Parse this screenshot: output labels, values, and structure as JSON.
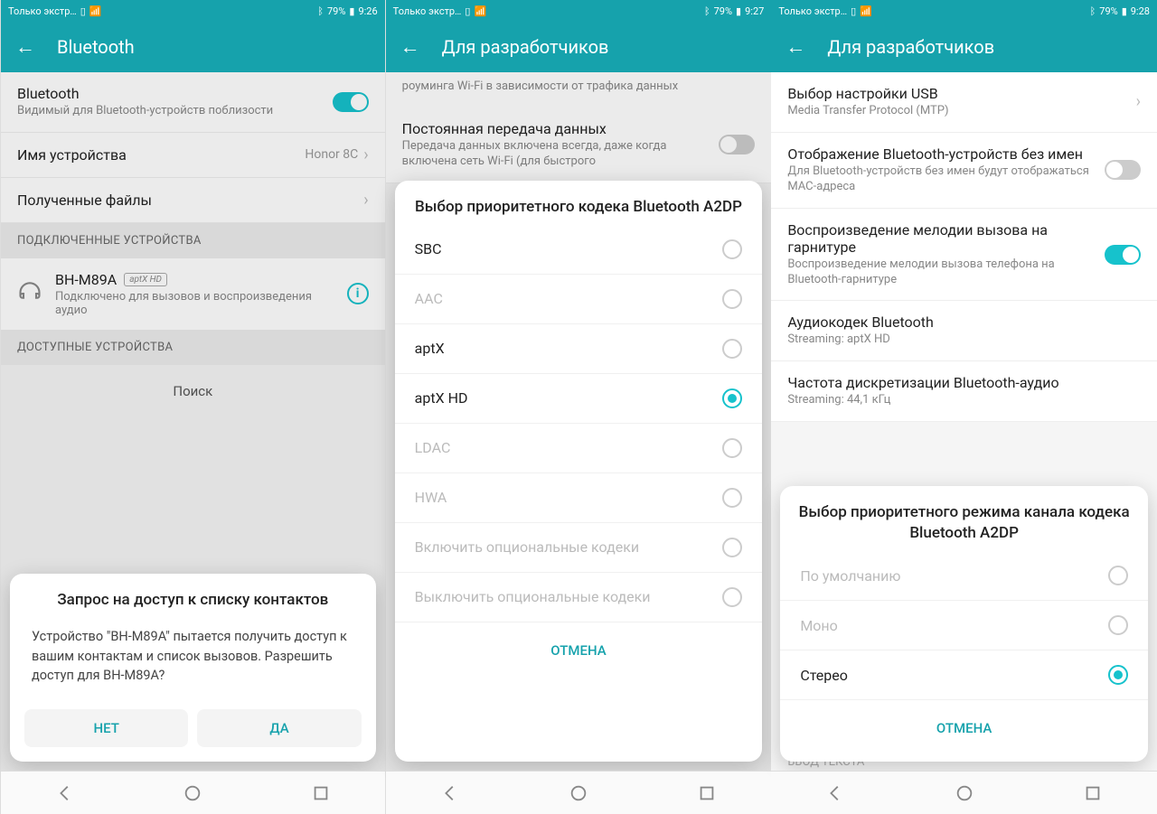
{
  "screens": [
    {
      "status": {
        "carrier": "Только экстр…",
        "battery": "79%",
        "time": "9:26"
      },
      "appbar_title": "Bluetooth",
      "bt_toggle": {
        "title": "Bluetooth",
        "sub": "Видимый для Bluetooth-устройств поблизости"
      },
      "device_name_row": {
        "label": "Имя устройства",
        "value": "Honor 8C"
      },
      "received_files": "Полученные файлы",
      "section_connected": "ПОДКЛЮЧЕННЫЕ УСТРОЙСТВА",
      "device": {
        "name": "BH-M89A",
        "badge": "aptX HD",
        "status": "Подключено для вызовов и воспроизведения аудио"
      },
      "section_available": "ДОСТУПНЫЕ УСТРОЙСТВА",
      "search": "Поиск",
      "dialog": {
        "title": "Запрос на доступ к списку контактов",
        "body": "Устройство \"BH-M89A\" пытается получить доступ к вашим контактам и список вызовов. Разрешить доступ для BH-M89A?",
        "no": "НЕТ",
        "yes": "ДА"
      }
    },
    {
      "status": {
        "carrier": "Только экстр…",
        "battery": "79%",
        "time": "9:27"
      },
      "appbar_title": "Для разработчиков",
      "row1_sub": "роуминга Wi-Fi в зависимости от трафика данных",
      "row2": {
        "title": "Постоянная передача данных",
        "sub": "Передача данных включена всегда, даже когда включена сеть Wi-Fi (для быстрого"
      },
      "dialog": {
        "title": "Выбор приоритетного кодека Bluetooth A2DP",
        "options": [
          {
            "label": "SBC",
            "selected": false,
            "disabled": false
          },
          {
            "label": "AAC",
            "selected": false,
            "disabled": true
          },
          {
            "label": "aptX",
            "selected": false,
            "disabled": false
          },
          {
            "label": "aptX HD",
            "selected": true,
            "disabled": false
          },
          {
            "label": "LDAC",
            "selected": false,
            "disabled": true
          },
          {
            "label": "HWA",
            "selected": false,
            "disabled": true
          },
          {
            "label": "Включить опциональные кодеки",
            "selected": false,
            "disabled": true
          },
          {
            "label": "Выключить опциональные кодеки",
            "selected": false,
            "disabled": true
          }
        ],
        "cancel": "ОТМЕНА"
      }
    },
    {
      "status": {
        "carrier": "Только экстр…",
        "battery": "79%",
        "time": "9:28"
      },
      "appbar_title": "Для разработчиков",
      "rows": {
        "usb": {
          "title": "Выбор настройки USB",
          "sub": "Media Transfer Protocol (MTP)"
        },
        "btnoname": {
          "title": "Отображение Bluetooth-устройств без имен",
          "sub": "Для Bluetooth-устройств без имен будут отображаться MAC-адреса"
        },
        "ringtone": {
          "title": "Воспроизведение мелодии вызова на гарнитуре",
          "sub": "Воспроизведение мелодии вызова телефона на Bluetooth-гарнитуре"
        },
        "codec": {
          "title": "Аудиокодек Bluetooth",
          "sub": "Streaming: aptX HD"
        },
        "samplerate": {
          "title": "Частота дискретизации Bluetooth-аудио",
          "sub": "Streaming: 44,1 кГц"
        }
      },
      "partial_section": "ВВОД ТЕКСТА",
      "dialog": {
        "title": "Выбор приоритетного режима канала кодека Bluetooth A2DP",
        "options": [
          {
            "label": "По умолчанию",
            "selected": false,
            "disabled": true
          },
          {
            "label": "Моно",
            "selected": false,
            "disabled": true
          },
          {
            "label": "Стерео",
            "selected": true,
            "disabled": false
          }
        ],
        "cancel": "ОТМЕНА"
      }
    }
  ]
}
